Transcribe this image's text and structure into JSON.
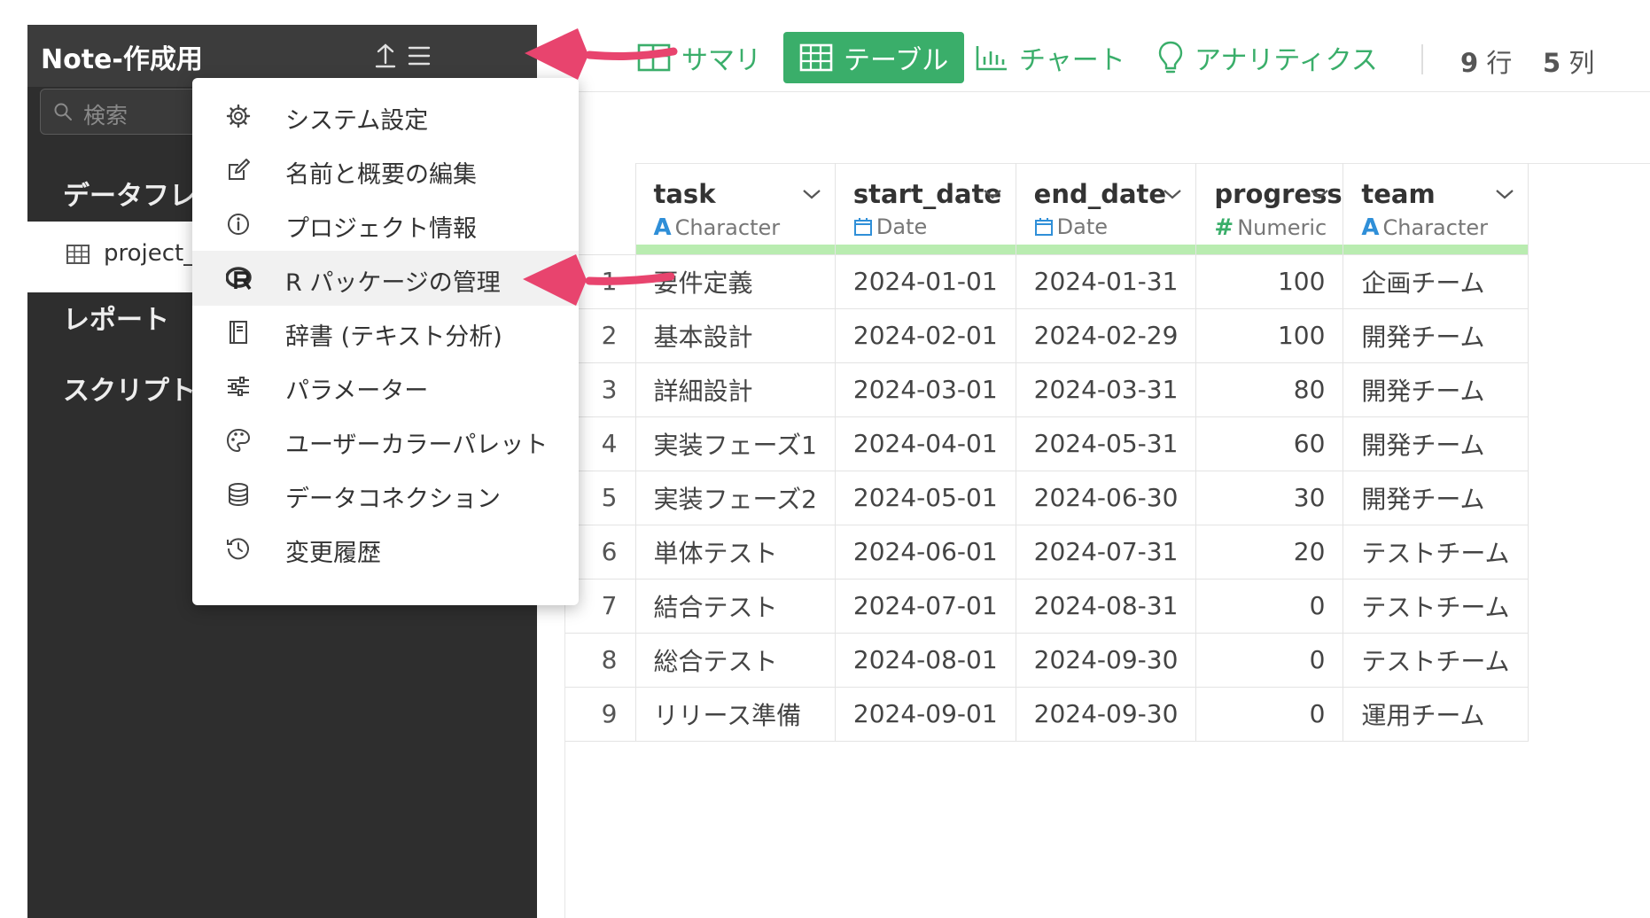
{
  "sidebar": {
    "title": "Note-作成用",
    "search_placeholder": "検索",
    "sections": [
      "データフレ",
      "レポート",
      "スクリプト"
    ],
    "item": "project_s"
  },
  "tabs": [
    {
      "label": "サマリ",
      "icon": "summary-icon",
      "active": false
    },
    {
      "label": "テーブル",
      "icon": "table-icon",
      "active": true
    },
    {
      "label": "チャート",
      "icon": "chart-icon",
      "active": false
    },
    {
      "label": "アナリティクス",
      "icon": "lightbulb-icon",
      "active": false
    }
  ],
  "counts": {
    "rows_num": "9",
    "rows_label": "行",
    "cols_num": "5",
    "cols_label": "列"
  },
  "menu": [
    {
      "label": "システム設定",
      "icon": "gear-icon"
    },
    {
      "label": "名前と概要の編集",
      "icon": "edit-icon"
    },
    {
      "label": "プロジェクト情報",
      "icon": "info-icon"
    },
    {
      "label": "R パッケージの管理",
      "icon": "r-logo-icon"
    },
    {
      "label": "辞書 (テキスト分析)",
      "icon": "book-icon"
    },
    {
      "label": "パラメーター",
      "icon": "sliders-icon"
    },
    {
      "label": "ユーザーカラーパレット",
      "icon": "palette-icon"
    },
    {
      "label": "データコネクション",
      "icon": "database-icon"
    },
    {
      "label": "変更履歴",
      "icon": "history-icon"
    }
  ],
  "table": {
    "columns": [
      {
        "name": "task",
        "type": "Character",
        "type_icon": "A"
      },
      {
        "name": "start_date",
        "type": "Date",
        "type_icon": "calendar-icon"
      },
      {
        "name": "end_date",
        "type": "Date",
        "type_icon": "calendar-icon"
      },
      {
        "name": "progress",
        "type": "Numeric",
        "type_icon": "#"
      },
      {
        "name": "team",
        "type": "Character",
        "type_icon": "A"
      }
    ],
    "rows": [
      [
        "1",
        "要件定義",
        "2024-01-01",
        "2024-01-31",
        "100",
        "企画チーム"
      ],
      [
        "2",
        "基本設計",
        "2024-02-01",
        "2024-02-29",
        "100",
        "開発チーム"
      ],
      [
        "3",
        "詳細設計",
        "2024-03-01",
        "2024-03-31",
        "80",
        "開発チーム"
      ],
      [
        "4",
        "実装フェーズ1",
        "2024-04-01",
        "2024-05-31",
        "60",
        "開発チーム"
      ],
      [
        "5",
        "実装フェーズ2",
        "2024-05-01",
        "2024-06-30",
        "30",
        "開発チーム"
      ],
      [
        "6",
        "単体テスト",
        "2024-06-01",
        "2024-07-31",
        "20",
        "テストチーム"
      ],
      [
        "7",
        "結合テスト",
        "2024-07-01",
        "2024-08-31",
        "0",
        "テストチーム"
      ],
      [
        "8",
        "総合テスト",
        "2024-08-01",
        "2024-09-30",
        "0",
        "テストチーム"
      ],
      [
        "9",
        "リリース準備",
        "2024-09-01",
        "2024-09-30",
        "0",
        "運用チーム"
      ]
    ]
  },
  "colors": {
    "accent": "#3aae6a",
    "arrow": "#e8446e",
    "sidebar": "#2e2e2e",
    "type_char": "#2f8fd8",
    "header_bar": "#b9ecb0"
  }
}
